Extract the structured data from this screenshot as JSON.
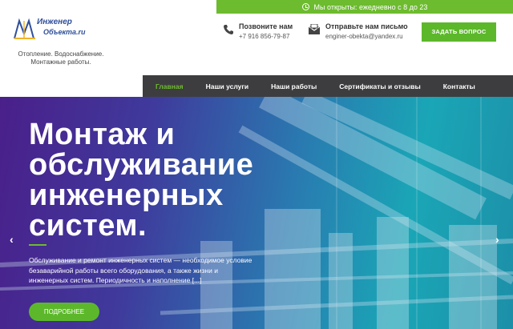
{
  "topbar": {
    "hours": "Мы открыты: ежедневно с 8 до 23"
  },
  "logo": {
    "name_line1": "Инженер",
    "name_line2": "Объекта.ru",
    "tagline": "Отопление. Водоснабжение. Монтажные работы."
  },
  "contacts": {
    "phone_label": "Позвоните нам",
    "phone": "+7 916 856-79-87",
    "mail_label": "Отправьте нам письмо",
    "email": "enginer-obekta@yandex.ru"
  },
  "header": {
    "ask_button": "ЗАДАТЬ ВОПРОС"
  },
  "nav": {
    "items": [
      {
        "label": "Главная",
        "active": true
      },
      {
        "label": "Наши услуги"
      },
      {
        "label": "Наши работы"
      },
      {
        "label": "Сертификаты и отзывы"
      },
      {
        "label": "Контакты"
      }
    ]
  },
  "hero": {
    "title": "Монтаж и обслуживание инженерных систем.",
    "text": "Обслуживание и ремонт инженерных систем — необходимое условие безаварийной работы всего оборудования, а также жизни и инженерных систем. Периодичность и наполнение [...]",
    "more_button": "ПОДРОБНЕЕ",
    "arrow_left": "‹",
    "arrow_right": "›"
  },
  "colors": {
    "accent": "#6dbb2f",
    "nav_bg": "#3d3d3f",
    "logo_blue": "#2f4f9a"
  }
}
